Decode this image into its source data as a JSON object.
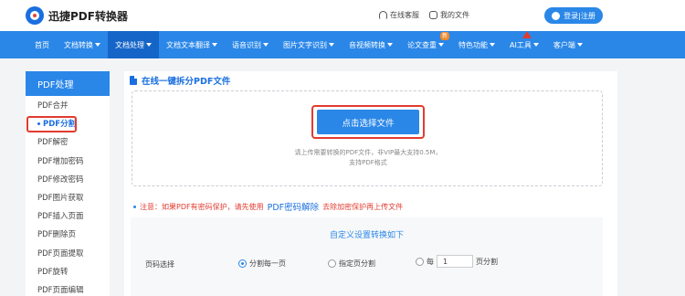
{
  "header": {
    "brand": "迅捷PDF转换器",
    "service": "在线客服",
    "my_files": "我的文件",
    "login": "登录|注册"
  },
  "nav": {
    "items": [
      {
        "label": "首页",
        "caret": false
      },
      {
        "label": "文档转换",
        "caret": true
      },
      {
        "label": "文档处理",
        "caret": true,
        "active": true
      },
      {
        "label": "文档文本翻译",
        "caret": true
      },
      {
        "label": "语音识别",
        "caret": true
      },
      {
        "label": "图片文字识别",
        "caret": true
      },
      {
        "label": "音视频转换",
        "caret": true
      },
      {
        "label": "论文查重",
        "caret": true,
        "badge": "新"
      },
      {
        "label": "特色功能",
        "caret": true
      },
      {
        "label": "AI工具",
        "caret": true,
        "arrow": true
      },
      {
        "label": "客户端",
        "caret": true
      }
    ]
  },
  "sidebar": {
    "title": "PDF处理",
    "items": [
      "PDF合并",
      "PDF分割",
      "PDF解密",
      "PDF增加密码",
      "PDF修改密码",
      "PDF图片获取",
      "PDF插入页面",
      "PDF删除页",
      "PDF页面提取",
      "PDF旋转",
      "PDF页面编辑"
    ],
    "active_index": 1
  },
  "main": {
    "title": "在线一键拆分PDF文件",
    "upload_button": "点击选择文件",
    "hint_line1": "请上传需要转换的PDF文件，非VIP最大支持0.5M，",
    "hint_line2": "支持PDF格式",
    "notice_prefix": "注意：如果PDF有密码保护，请先使用",
    "notice_link": "PDF密码解除",
    "notice_suffix": "去除加密保护再上传文件",
    "settings_title": "自定义设置转换如下",
    "option_label": "页码选择",
    "radio_each": "分割每一页",
    "radio_range": "指定页分割",
    "radio_every_prefix": "每",
    "every_value": "1",
    "radio_every_suffix": "页分割"
  },
  "colors": {
    "primary": "#2a87e8",
    "nav_active": "#1565c8",
    "highlight_ring": "#e23b30",
    "notice": "#e23b30"
  }
}
